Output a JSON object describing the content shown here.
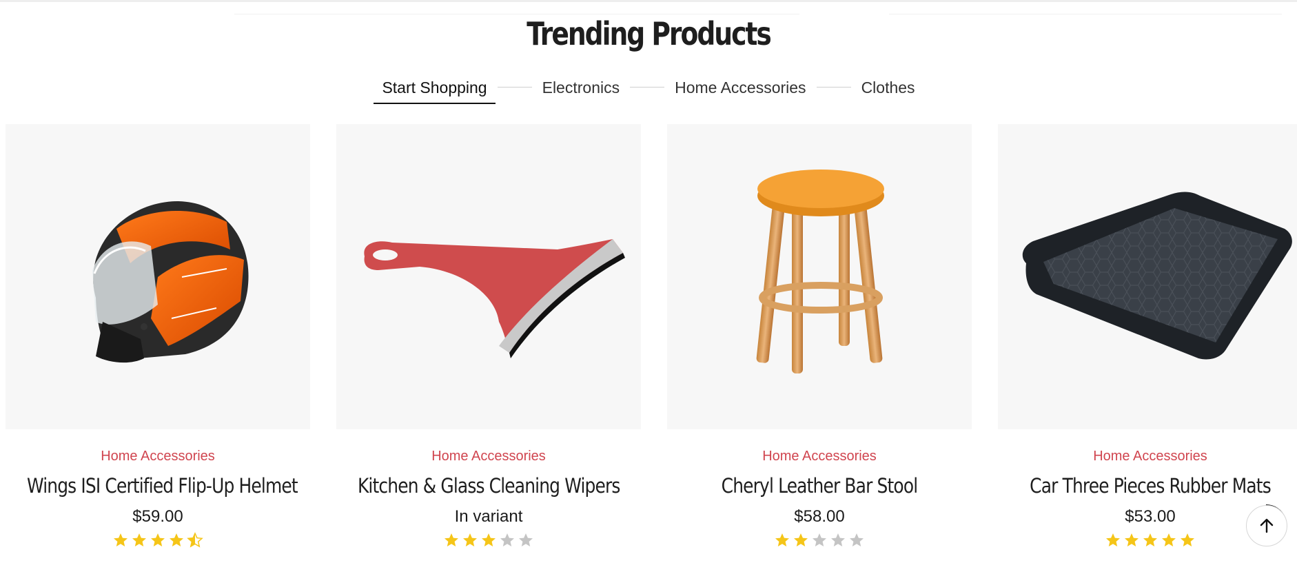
{
  "section": {
    "title": "Trending Products"
  },
  "tabs": [
    {
      "label": "Start Shopping",
      "active": true
    },
    {
      "label": "Electronics",
      "active": false
    },
    {
      "label": "Home Accessories",
      "active": false
    },
    {
      "label": "Clothes",
      "active": false
    }
  ],
  "products": [
    {
      "category": "Home Accessories",
      "name": "Wings ISI Certified Flip-Up Helmet",
      "price": "$59.00",
      "rating": 4.5,
      "image": "helmet-image"
    },
    {
      "category": "Home Accessories",
      "name": "Kitchen & Glass Cleaning Wipers",
      "price": "In variant",
      "rating": 3,
      "image": "wiper-image"
    },
    {
      "category": "Home Accessories",
      "name": "Cheryl Leather Bar Stool",
      "price": "$58.00",
      "rating": 2,
      "image": "stool-image"
    },
    {
      "category": "Home Accessories",
      "name": "Car Three Pieces Rubber Mats",
      "price": "$53.00",
      "rating": 5,
      "image": "mat-image"
    }
  ],
  "colors": {
    "accent": "#d0454f",
    "star_filled": "#f5c518",
    "star_empty": "#c4c4c4"
  },
  "icons": {
    "scroll_top": "arrow-up-icon"
  }
}
